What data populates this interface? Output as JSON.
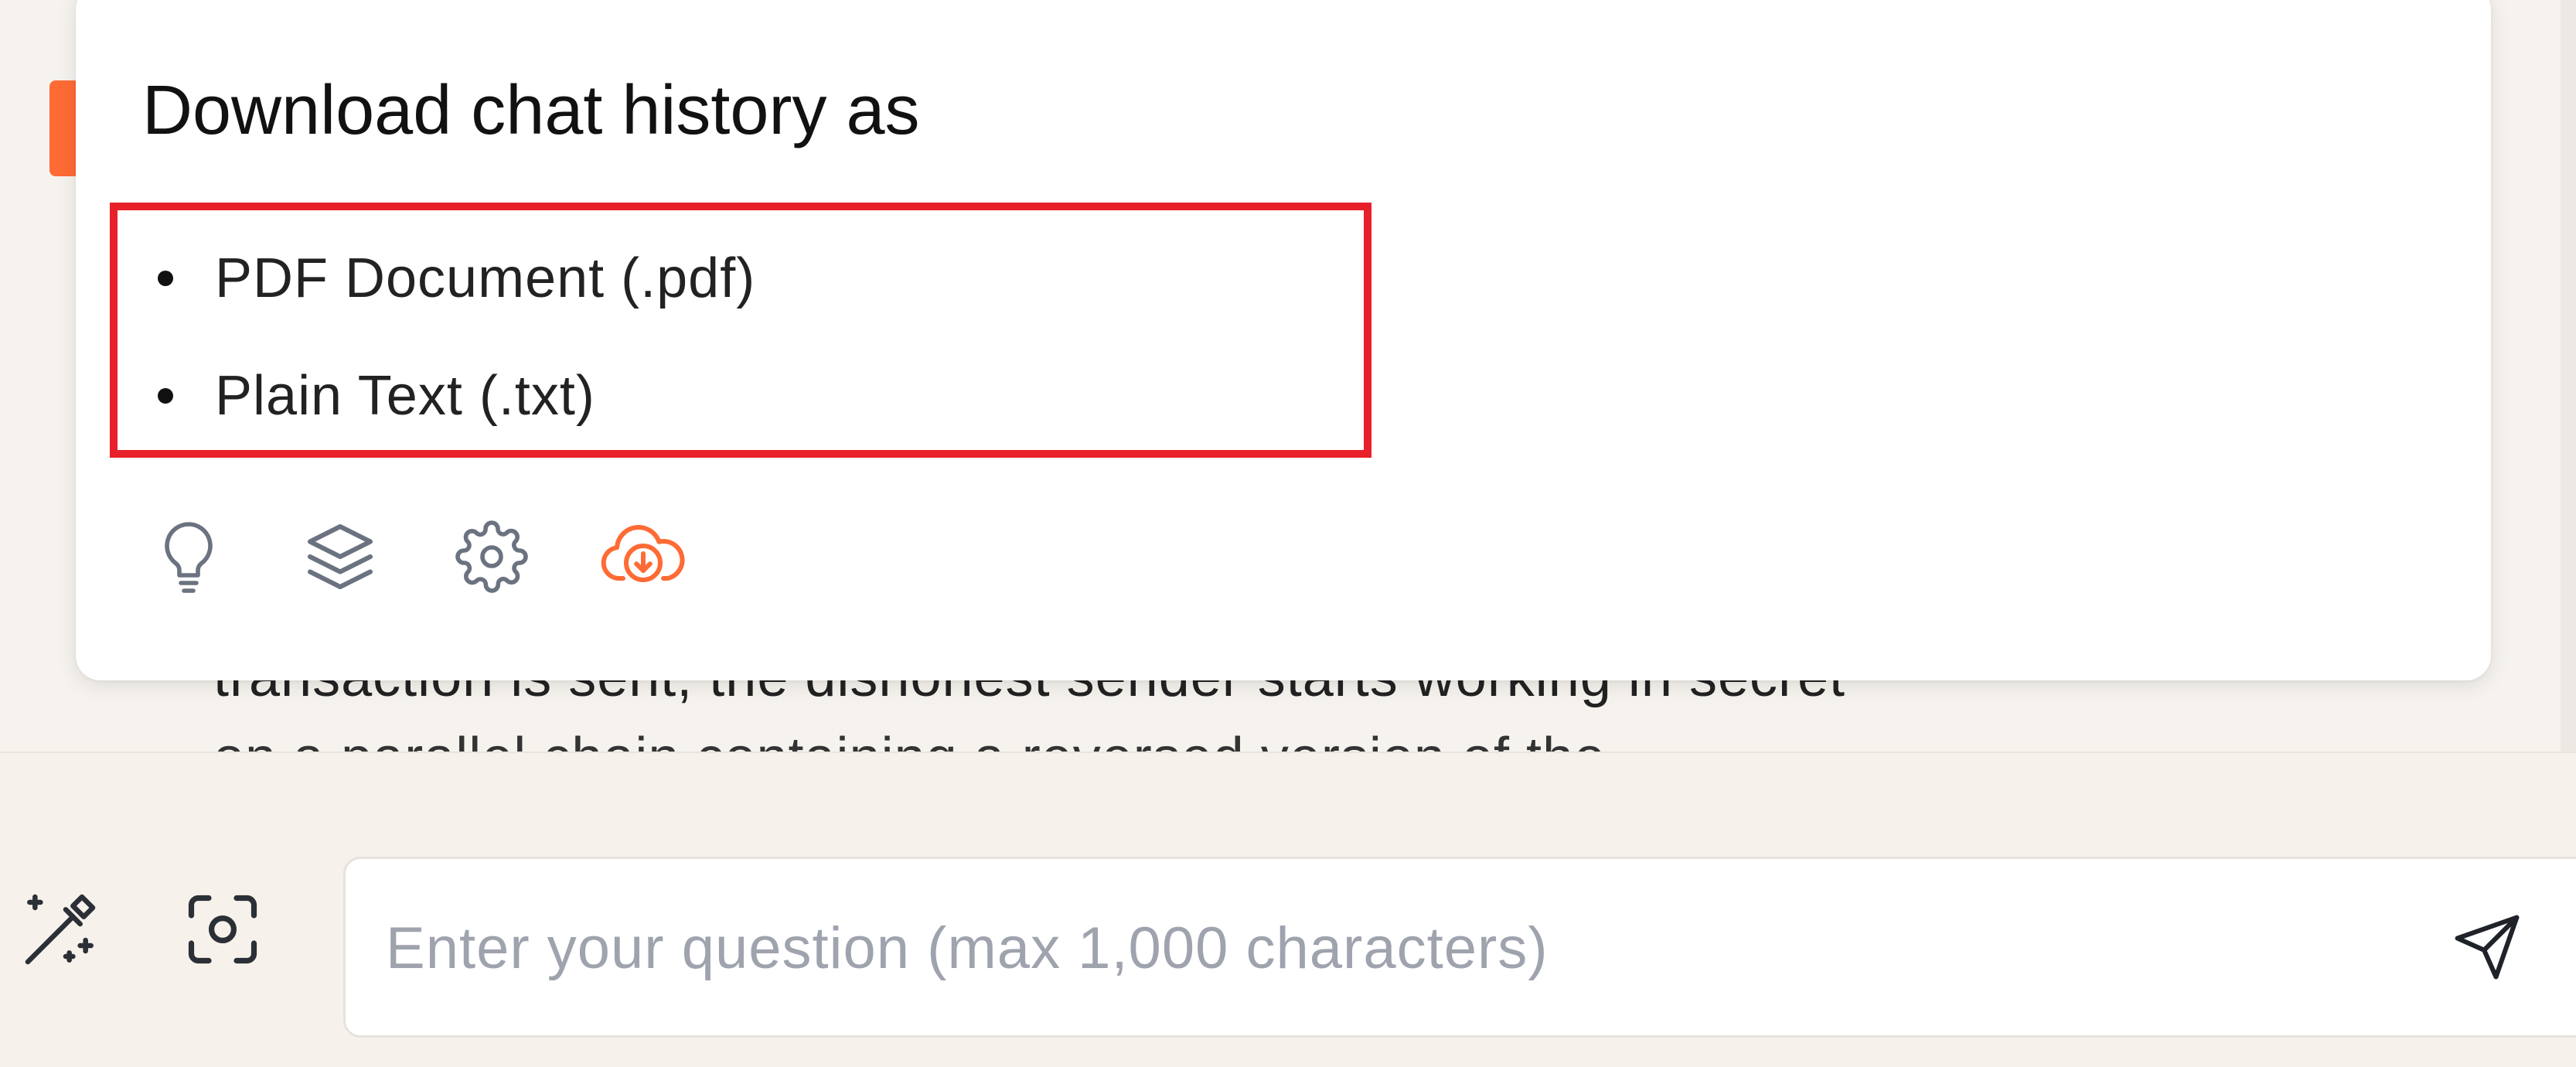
{
  "chat": {
    "visible_text_line_1": "transaction is sent, the dishonest sender starts working in secret",
    "visible_text_line_2": "on a parallel chain containing a reversed version of the"
  },
  "popup": {
    "title": "Download chat history as",
    "options": [
      {
        "label": "PDF Document (.pdf)"
      },
      {
        "label": "Plain Text (.txt)"
      }
    ],
    "toolbar": [
      {
        "icon": "lightbulb-icon"
      },
      {
        "icon": "layers-icon"
      },
      {
        "icon": "gear-icon"
      },
      {
        "icon": "cloud-download-icon",
        "active": true
      }
    ]
  },
  "composer": {
    "placeholder": "Enter your question (max 1,000 characters)",
    "value": "",
    "left_tools": [
      {
        "icon": "magic-wand-icon"
      },
      {
        "icon": "screen-capture-icon"
      }
    ],
    "send_icon": "send-icon"
  },
  "colors": {
    "accent": "#ff6b35",
    "highlight_border": "#e8202a",
    "background": "#f6f3ee",
    "icon_gray": "#6b7280"
  }
}
